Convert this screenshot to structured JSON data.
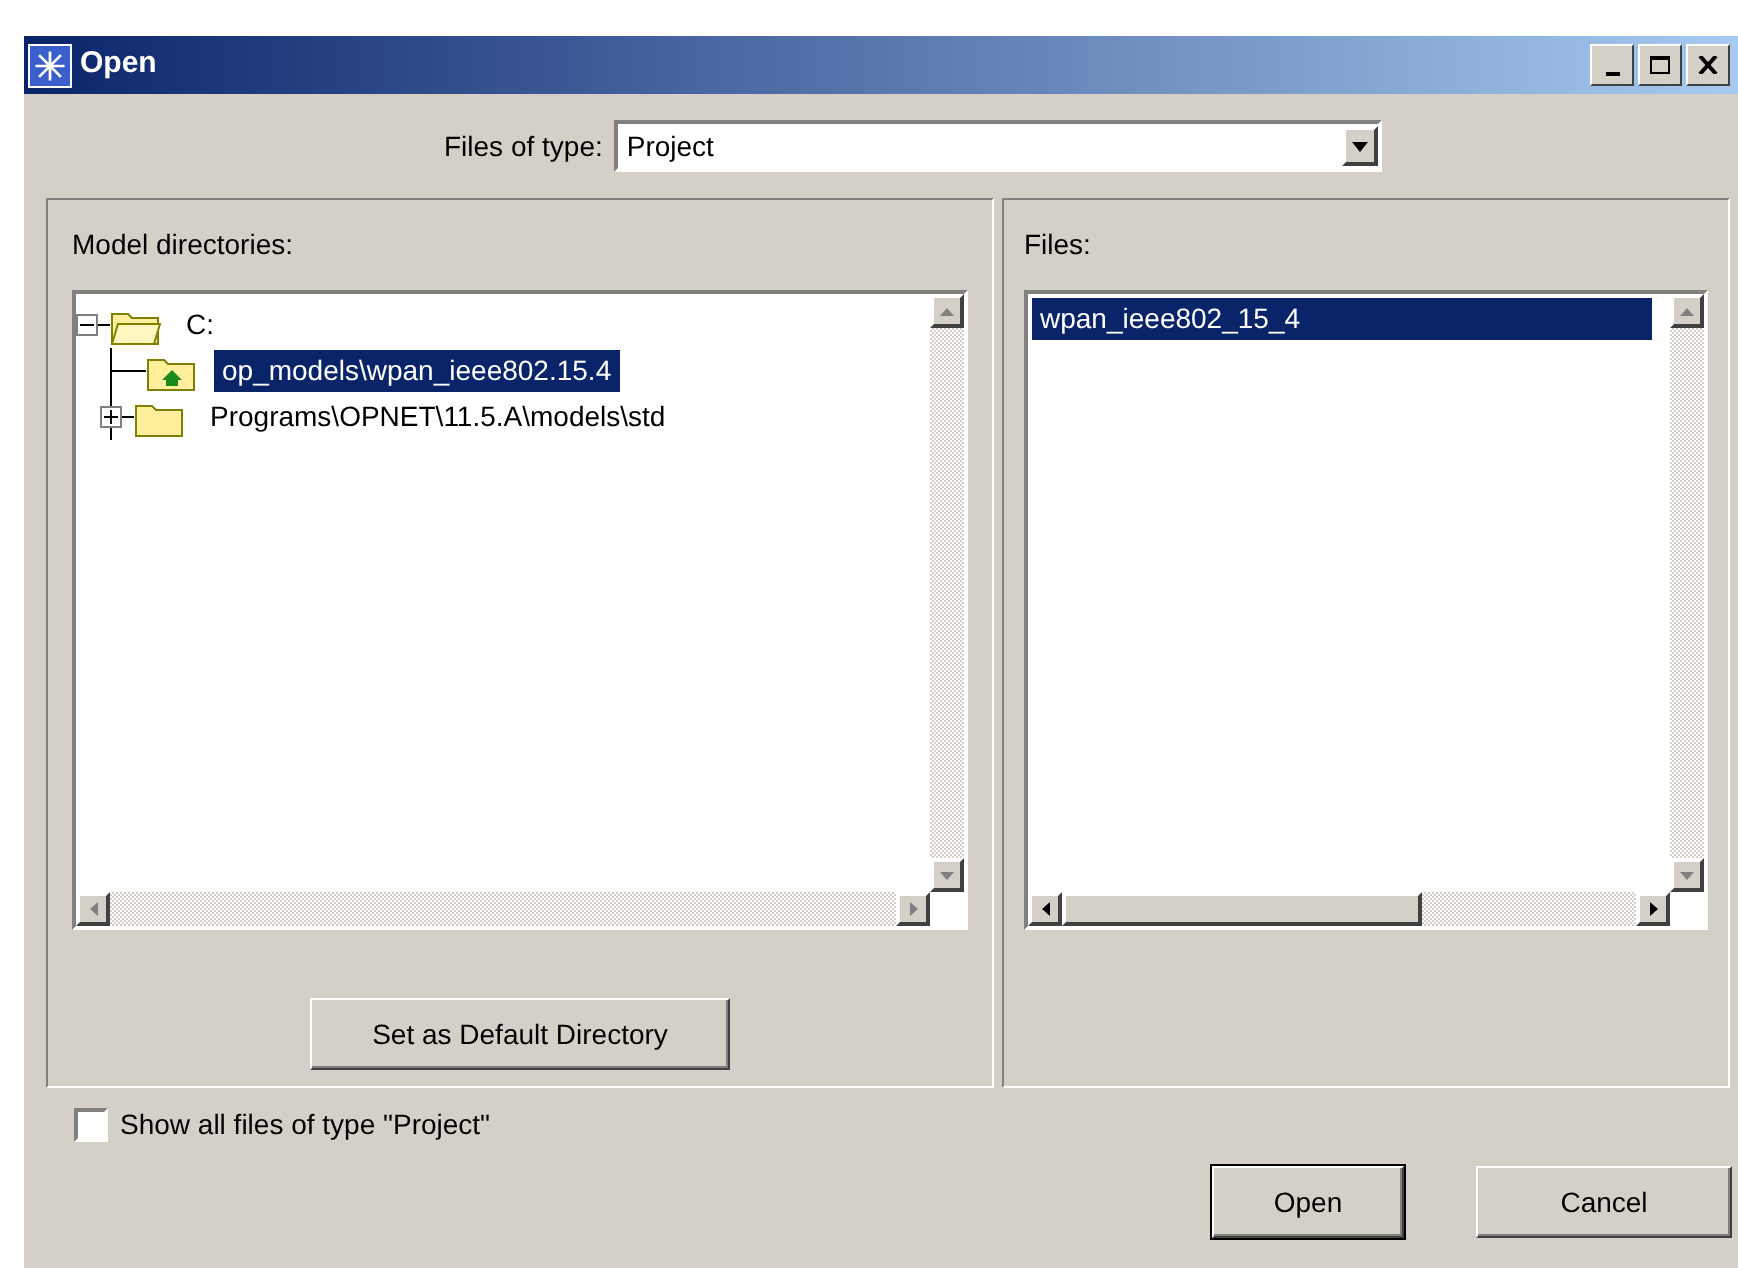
{
  "window": {
    "title": "Open"
  },
  "file_type": {
    "label": "Files of type:",
    "value": "Project"
  },
  "directories": {
    "label": "Model directories:",
    "tree": [
      {
        "name": "C:",
        "kind": "folder",
        "expanded": true,
        "selected": false,
        "children": [
          {
            "name": "op_models\\wpan_ieee802.15.4",
            "kind": "home",
            "selected": true
          },
          {
            "name": "Programs\\OPNET\\11.5.A\\models\\std",
            "kind": "folder",
            "expanded": false,
            "selected": false
          }
        ]
      }
    ],
    "button": "Set as Default Directory"
  },
  "files": {
    "label": "Files:",
    "items": [
      {
        "name": "wpan_ieee802_15_4",
        "selected": true
      }
    ]
  },
  "show_all": {
    "label": "Show all files of type \"Project\"",
    "checked": false
  },
  "buttons": [
    {
      "label": "Open",
      "default": true
    },
    {
      "label": "Cancel",
      "default": false
    }
  ]
}
